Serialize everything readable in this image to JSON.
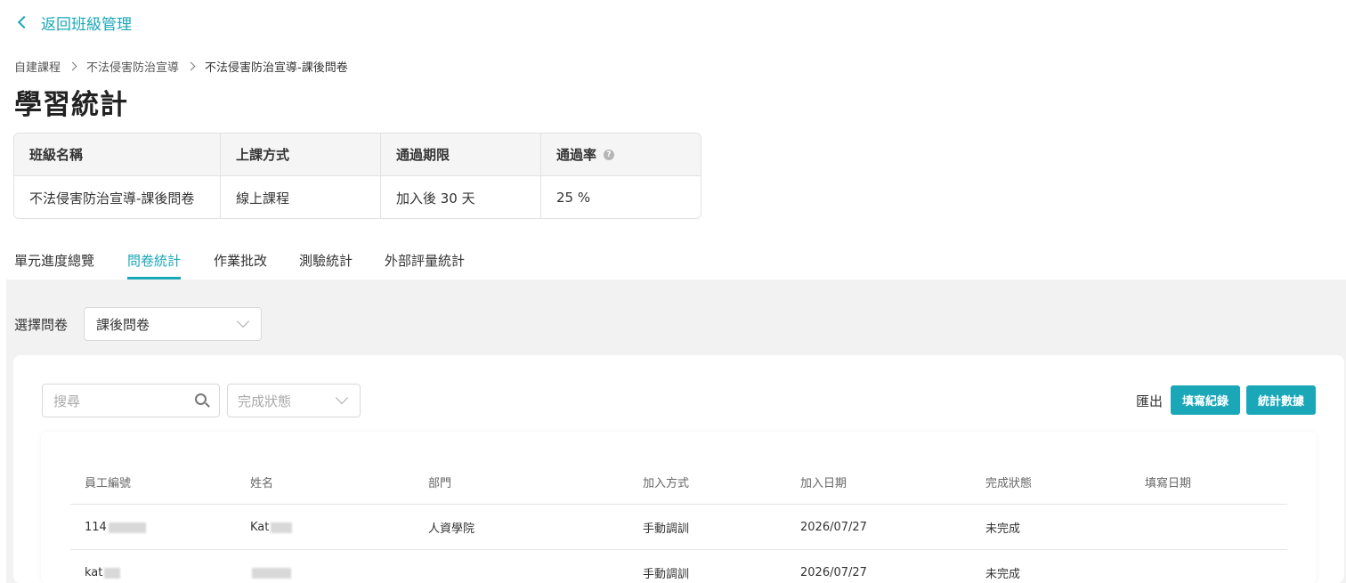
{
  "back_link": {
    "label": "返回班級管理"
  },
  "breadcrumb": [
    "自建課程",
    "不法侵害防治宣導",
    "不法侵害防治宣導-課後問卷"
  ],
  "page_title": "學習統計",
  "summary": {
    "headers": [
      "班級名稱",
      "上課方式",
      "通過期限",
      "通過率"
    ],
    "values": [
      "不法侵害防治宣導-課後問卷",
      "線上課程",
      "加入後 30 天",
      "25 %"
    ]
  },
  "tabs": [
    {
      "label": "單元進度總覽",
      "active": false
    },
    {
      "label": "問卷統計",
      "active": true
    },
    {
      "label": "作業批改",
      "active": false
    },
    {
      "label": "測驗統計",
      "active": false
    },
    {
      "label": "外部評量統計",
      "active": false
    }
  ],
  "survey_select": {
    "label": "選擇問卷",
    "value": "課後問卷"
  },
  "toolbar": {
    "search_placeholder": "搜尋",
    "status_placeholder": "完成狀態",
    "export_label": "匯出",
    "record_button": "填寫紀錄",
    "stats_button": "統計數據"
  },
  "table": {
    "columns": [
      "員工編號",
      "姓名",
      "部門",
      "加入方式",
      "加入日期",
      "完成狀態",
      "填寫日期"
    ],
    "rows": [
      {
        "id": "114",
        "name": "Kat",
        "dept": "人資學院",
        "join_method": "手動調訓",
        "join_date": "2026/07/27",
        "status": "未完成",
        "fill_date": ""
      },
      {
        "id": "kat",
        "name": "",
        "dept": "",
        "join_method": "手動調訓",
        "join_date": "2026/07/27",
        "status": "未完成",
        "fill_date": ""
      }
    ]
  },
  "colors": {
    "accent": "#1aa7b8",
    "background_gray": "#f2f2f2"
  },
  "icons": {
    "back": "chevron-left-icon",
    "help": "question-circle-icon",
    "search": "search-icon",
    "dropdown": "chevron-down-icon"
  }
}
